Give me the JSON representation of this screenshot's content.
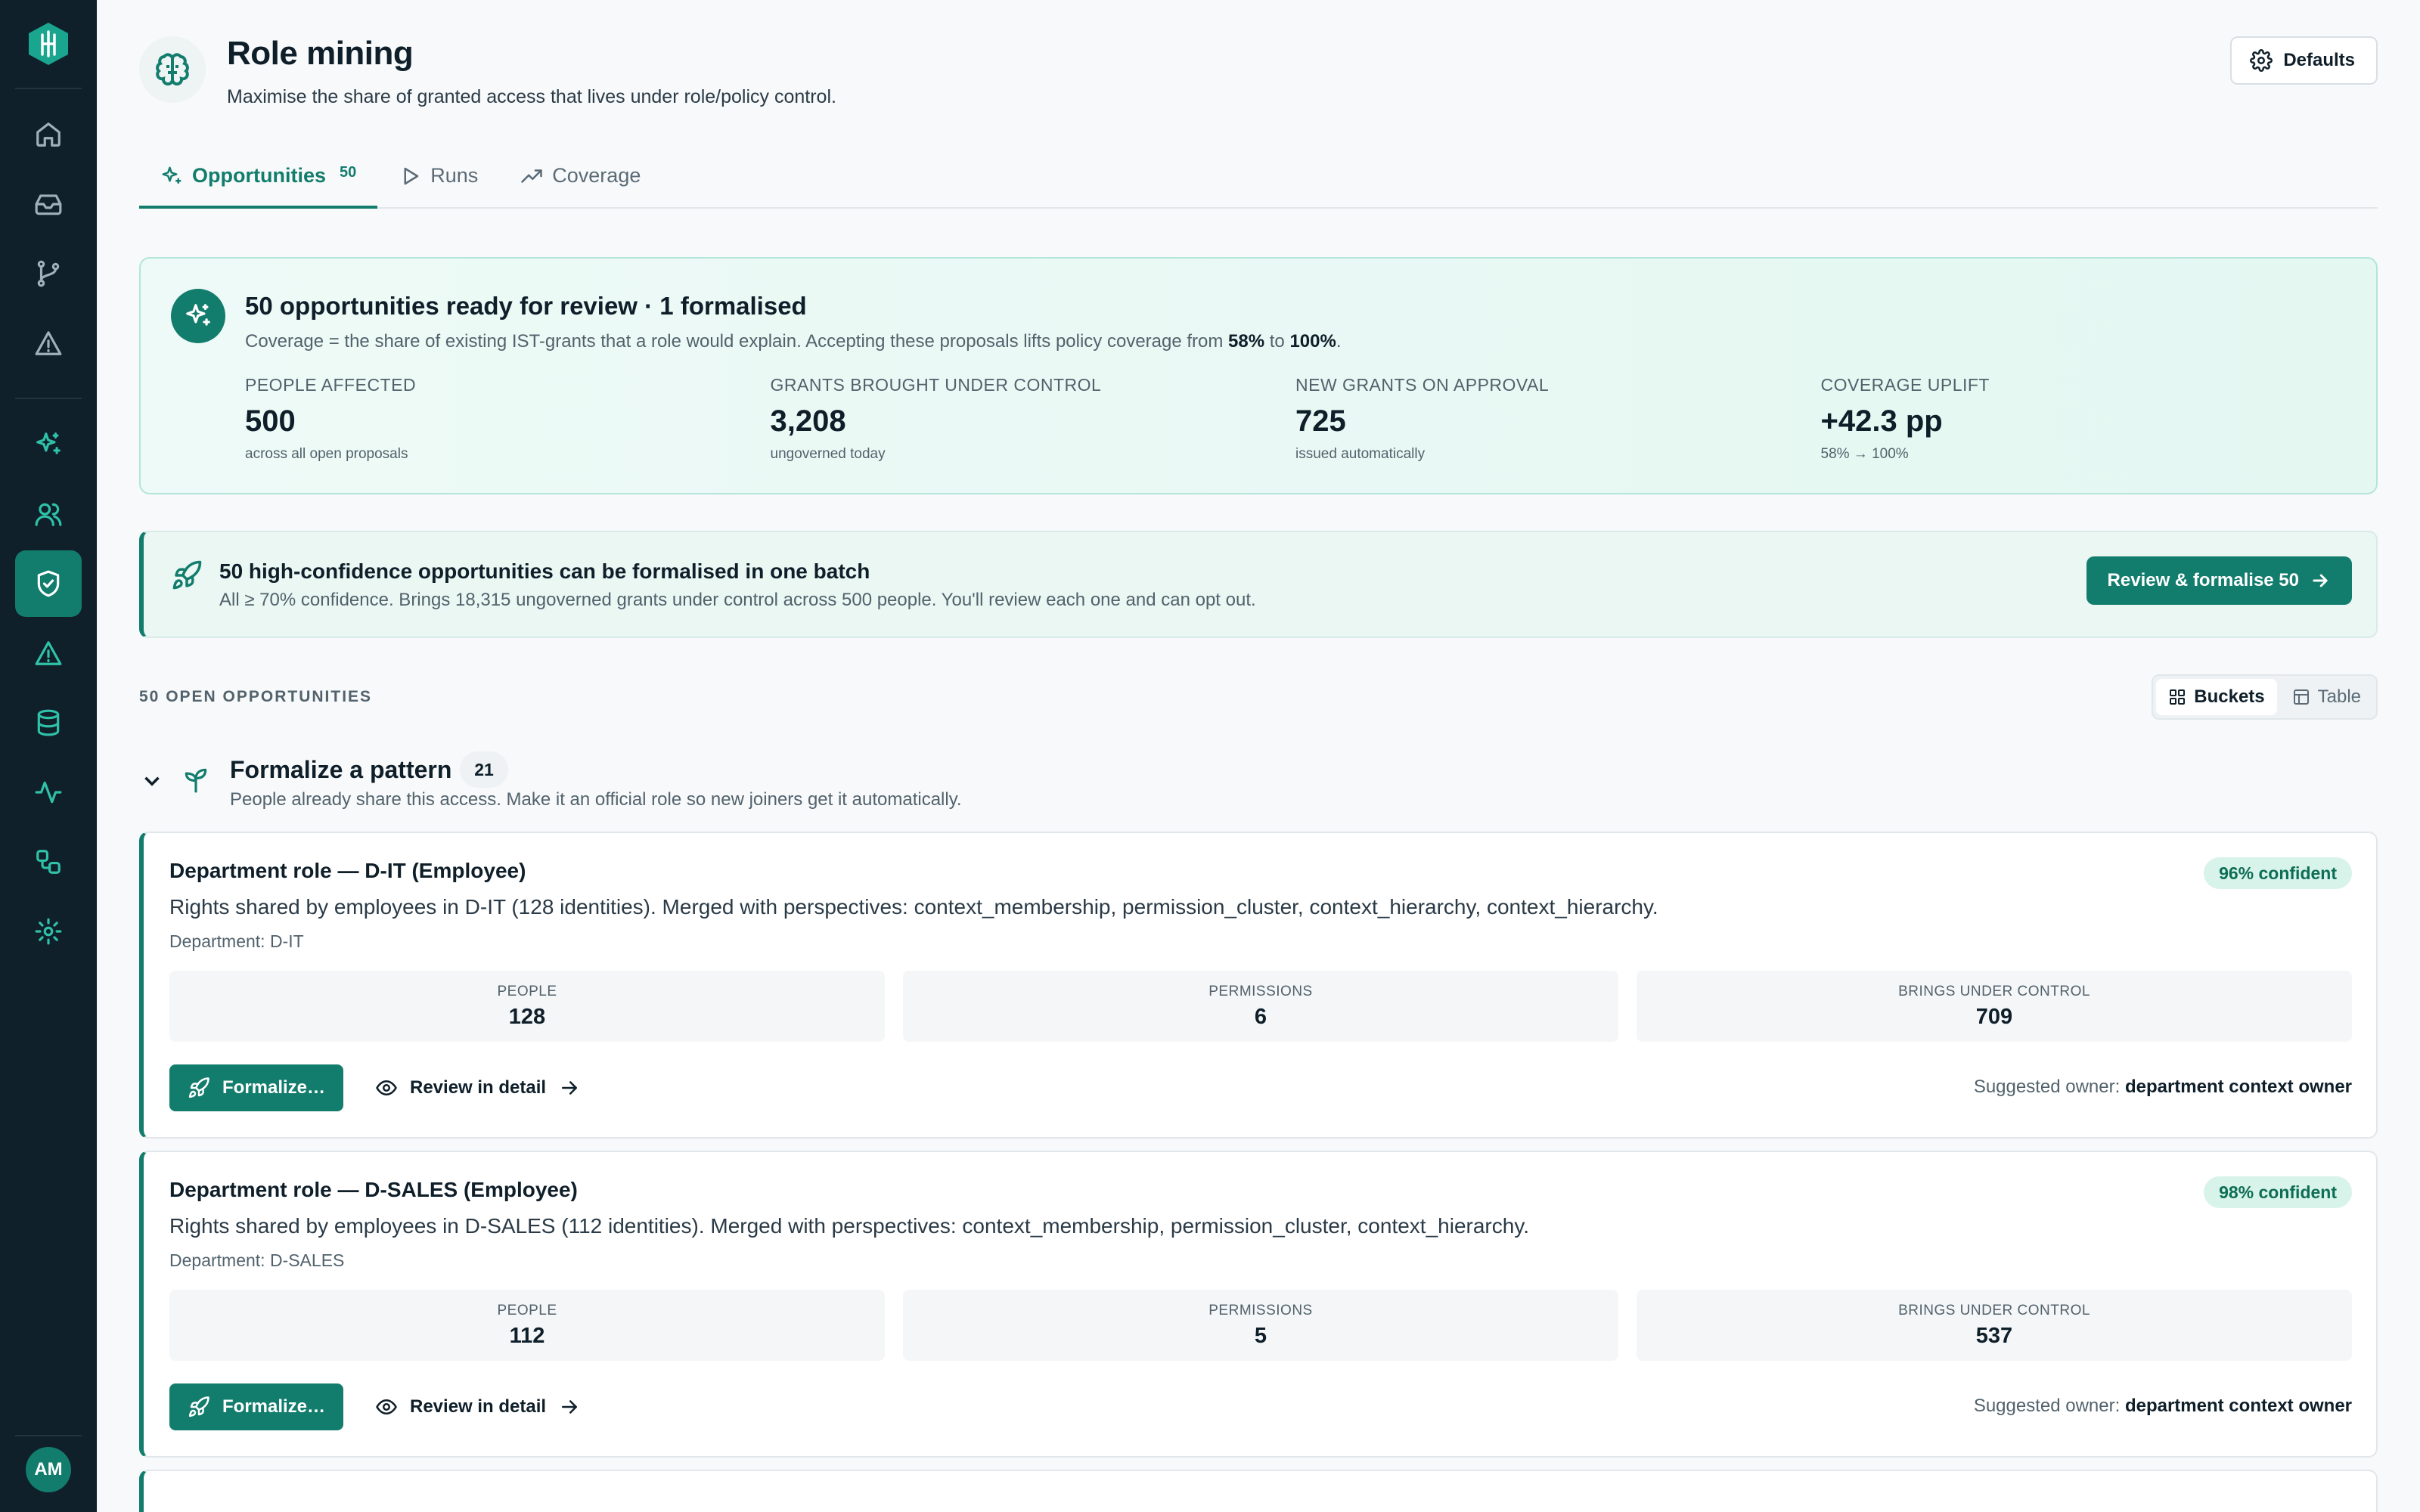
{
  "sidebar": {
    "logo": "app-logo",
    "user_initials": "AM",
    "items": [
      {
        "icon": "home-icon"
      },
      {
        "icon": "inbox-icon"
      },
      {
        "icon": "git-branch-icon"
      },
      {
        "icon": "warning-icon"
      },
      {
        "icon": "sparkles-icon"
      },
      {
        "icon": "users-icon"
      },
      {
        "icon": "shield-check-icon",
        "active": true
      },
      {
        "icon": "alert-triangle-icon"
      },
      {
        "icon": "database-icon"
      },
      {
        "icon": "activity-icon"
      },
      {
        "icon": "workflow-icon"
      },
      {
        "icon": "settings-icon"
      }
    ]
  },
  "header": {
    "title": "Role mining",
    "subtitle": "Maximise the share of granted access that lives under role/policy control.",
    "defaults_label": "Defaults"
  },
  "tabs": [
    {
      "label": "Opportunities",
      "count": "50",
      "active": true
    },
    {
      "label": "Runs"
    },
    {
      "label": "Coverage"
    }
  ],
  "summary": {
    "title": "50 opportunities ready for review · 1 formalised",
    "desc_prefix": "Coverage = the share of existing IST-grants that a role would explain. Accepting these proposals lifts policy coverage from ",
    "from": "58%",
    "to_word": " to ",
    "to": "100%",
    "desc_suffix": ".",
    "stats": [
      {
        "label": "PEOPLE AFFECTED",
        "value": "500",
        "note": "across all open proposals"
      },
      {
        "label": "GRANTS BROUGHT UNDER CONTROL",
        "value": "3,208",
        "note": "ungoverned today"
      },
      {
        "label": "NEW GRANTS ON APPROVAL",
        "value": "725",
        "note": "issued automatically"
      },
      {
        "label": "COVERAGE UPLIFT",
        "value": "+42.3 pp",
        "note": "58% → 100%"
      }
    ]
  },
  "batch": {
    "title": "50 high-confidence opportunities can be formalised in one batch",
    "desc": "All ≥ 70% confidence. Brings 18,315 ungoverned grants under control across 500 people. You'll review each one and can opt out.",
    "button": "Review & formalise 50"
  },
  "list": {
    "open_label": "50 OPEN OPPORTUNITIES",
    "view_buckets": "Buckets",
    "view_table": "Table"
  },
  "group": {
    "title": "Formalize a pattern",
    "count": "21",
    "subtitle": "People already share this access. Make it an official role so new joiners get it automatically."
  },
  "cards": [
    {
      "title": "Department role — D-IT (Employee)",
      "confidence": "96% confident",
      "desc": "Rights shared by employees in D-IT (128 identities). Merged with perspectives: context_membership, permission_cluster, context_hierarchy, context_hierarchy.",
      "dept": "Department: D-IT",
      "people_label": "PEOPLE",
      "people": "128",
      "perm_label": "PERMISSIONS",
      "perms": "6",
      "control_label": "BRINGS UNDER CONTROL",
      "control": "709",
      "formalize": "Formalize…",
      "review": "Review in detail",
      "owner_label": "Suggested owner: ",
      "owner": "department context owner"
    },
    {
      "title": "Department role — D-SALES (Employee)",
      "confidence": "98% confident",
      "desc": "Rights shared by employees in D-SALES (112 identities). Merged with perspectives: context_membership, permission_cluster, context_hierarchy.",
      "dept": "Department: D-SALES",
      "people_label": "PEOPLE",
      "people": "112",
      "perm_label": "PERMISSIONS",
      "perms": "5",
      "control_label": "BRINGS UNDER CONTROL",
      "control": "537",
      "formalize": "Formalize…",
      "review": "Review in detail",
      "owner_label": "Suggested owner: ",
      "owner": "department context owner"
    }
  ],
  "colors": {
    "accent": "#137d6d",
    "sidebar_bg": "#10202b",
    "confidence_bg": "#d8f3e9"
  }
}
